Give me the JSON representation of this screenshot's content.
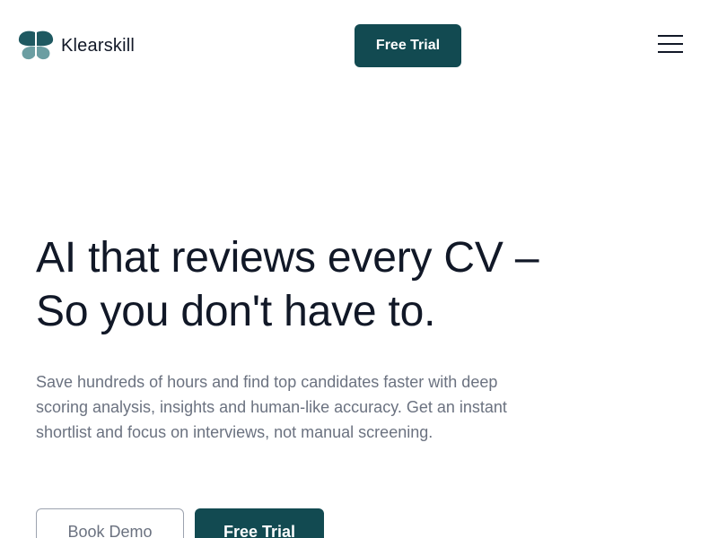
{
  "header": {
    "brand_name": "Klearskill",
    "logo_icon": "butterfly-logo-icon",
    "cta_label": "Free Trial",
    "menu_icon": "hamburger-menu-icon"
  },
  "hero": {
    "title_line_1": "AI that reviews every CV –",
    "title_line_2": "So you don't have to.",
    "subtitle": "Save hundreds of hours and find top candidates faster with deep scoring analysis, insights and human-like accuracy. Get an instant shortlist and focus on interviews, not manual screening.",
    "secondary_button": "Book Demo",
    "primary_button": "Free Trial"
  },
  "colors": {
    "brand_primary": "#124a51",
    "logo_dark": "#1f5961",
    "logo_light": "#6b9ea2",
    "text_dark": "#111827",
    "text_muted": "#6b7280"
  }
}
